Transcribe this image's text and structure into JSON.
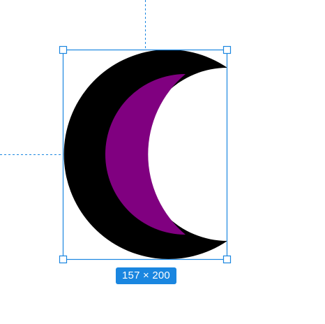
{
  "selection": {
    "dimensions_label": "157 × 200",
    "accent_color": "#1a86e0"
  },
  "shape": {
    "type": "crescent",
    "outline_color": "#000000",
    "fill_color": "#800080"
  }
}
